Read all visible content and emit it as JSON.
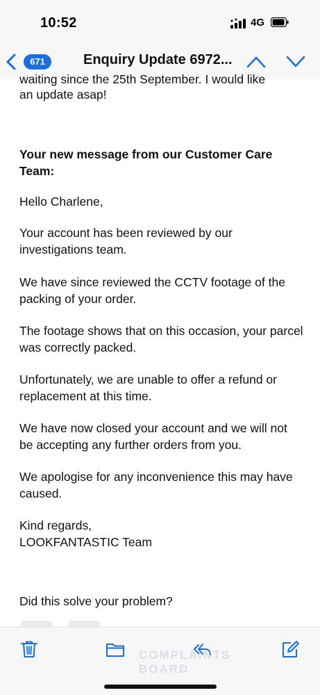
{
  "status": {
    "time": "10:52",
    "network": "4G",
    "signal_icon": "signal-bars-icon",
    "battery_icon": "battery-icon"
  },
  "nav": {
    "back_icon": "chevron-left-icon",
    "unread_count": "671",
    "title": "Enquiry Update 6972...",
    "prev_icon": "chevron-up-icon",
    "next_icon": "chevron-down-icon"
  },
  "email": {
    "clipped_top_line": "waiting since the 25th September. I would like",
    "previous_tail": "an update asap!",
    "heading": "Your new message from our Customer Care Team:",
    "greeting": "Hello Charlene,",
    "paragraphs": [
      "Your account has been reviewed by our investigations team.",
      "We have since reviewed the CCTV footage of the packing of your order.",
      "The footage shows that on this occasion, your parcel was correctly packed.",
      "Unfortunately, we are unable to offer a refund or replacement at this time.",
      "We have now closed your account and we will not be accepting any further orders from you.",
      "We apologise for any inconvenience this may have caused."
    ],
    "signoff": "Kind regards,",
    "signature": "LOOKFANTASTIC Team",
    "feedback_question": "Did this solve your problem?"
  },
  "toolbar": {
    "delete_icon": "trash-icon",
    "move_icon": "folder-icon",
    "reply_icon": "reply-icon",
    "compose_icon": "compose-icon"
  },
  "watermark": {
    "line1": "COMPLAINTS",
    "line2": "BOARD"
  },
  "colors": {
    "accent": "#1a6fe0",
    "bar_background": "#f7f7f7",
    "text": "#111111"
  }
}
